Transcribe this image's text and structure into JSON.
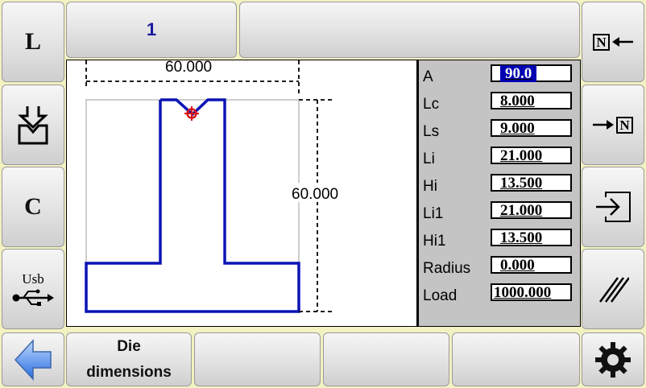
{
  "header": {
    "tab_number": "1"
  },
  "left_toolbar": {
    "l_button": "L",
    "c_button": "C",
    "usb_label": "Usb"
  },
  "drawing": {
    "dim_width": "60.000",
    "dim_height": "60.000"
  },
  "parameters": [
    {
      "label": "A",
      "value": "90.0",
      "active": true
    },
    {
      "label": "Lc",
      "value": "8.000"
    },
    {
      "label": "Ls",
      "value": "9.000"
    },
    {
      "label": "Li",
      "value": "21.000"
    },
    {
      "label": "Hi",
      "value": "13.500"
    },
    {
      "label": "Li1",
      "value": "21.000"
    },
    {
      "label": "Hi1",
      "value": "13.500"
    },
    {
      "label": "Radius",
      "value": "0.000"
    },
    {
      "label": "Load",
      "value": "1000.000"
    }
  ],
  "right_toolbar": {
    "export_label": "N"
  },
  "bottom_bar": {
    "softkey1_line1": "Die",
    "softkey1_line2": "dimensions"
  },
  "colors": {
    "accent_blue": "#0000b0",
    "profile_blue": "#0a14b4",
    "tip_red": "#d81818",
    "background": "#f2f2c2"
  }
}
